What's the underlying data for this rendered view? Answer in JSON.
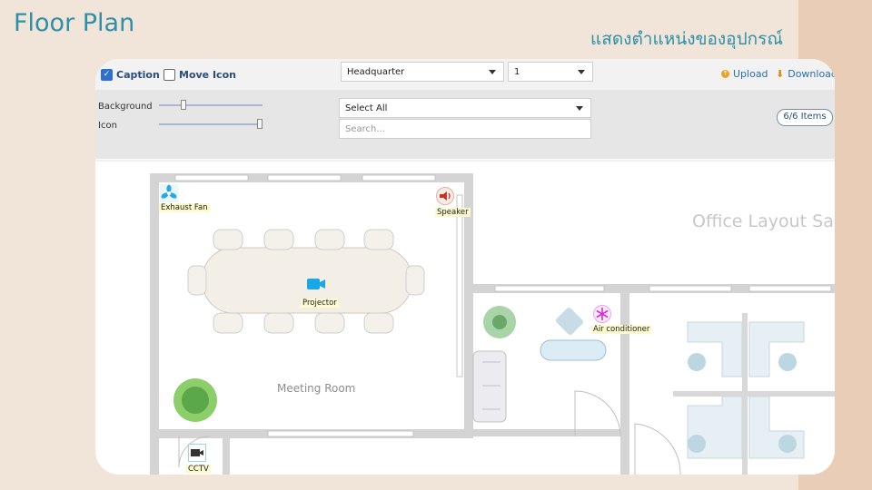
{
  "slide": {
    "title": "Floor Plan",
    "subtitle": "แสดงตำแหน่งของอุปกรณ์"
  },
  "toolbar": {
    "caption_label": "Caption",
    "caption_checked": true,
    "move_icon_label": "Move Icon",
    "move_icon_checked": false,
    "building_select": "Headquarter",
    "floor_select": "1",
    "upload_label": "Upload",
    "download_label": "Download"
  },
  "controls": {
    "background_label": "Background",
    "icon_label": "Icon",
    "background_level": 0.22,
    "icon_level": 1.0,
    "filter_select": "Select All",
    "search_placeholder": "Search...",
    "items_count": "6/6 Items"
  },
  "floorplan": {
    "meeting_room_label": "Meeting Room",
    "office_label": "Office Layout Sample",
    "devices": [
      {
        "caption": "Exhaust Fan",
        "icon": "fan-icon",
        "color": "#29a9e1"
      },
      {
        "caption": "Speaker",
        "icon": "speaker-icon",
        "color": "#c0392b"
      },
      {
        "caption": "Projector",
        "icon": "projector-icon",
        "color": "#18a8e8"
      },
      {
        "caption": "Air conditioner",
        "icon": "snowflake-icon",
        "color": "#d62fd6"
      },
      {
        "caption": "CCTV",
        "icon": "camera-icon",
        "color": "#333333"
      }
    ]
  },
  "colors": {
    "accent": "#2e8fa6",
    "wall": "#d6d6d6",
    "caption_bg": "#fdfad0"
  }
}
